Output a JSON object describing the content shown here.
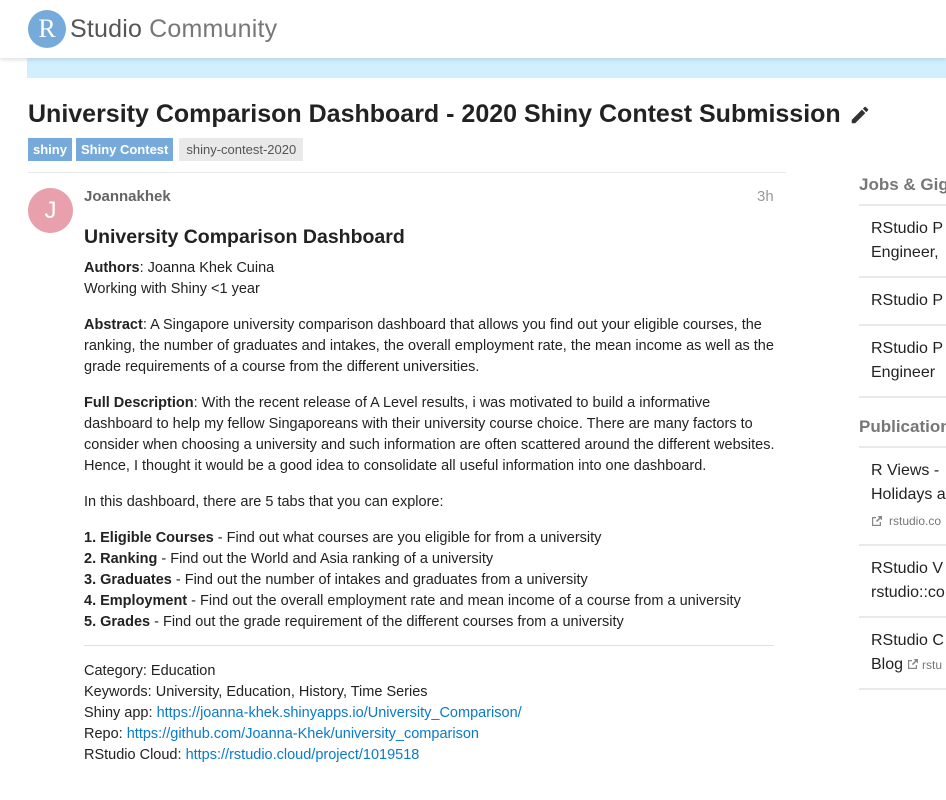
{
  "header": {
    "logo_letter": "R",
    "logo_studio": "Studio",
    "logo_community": "Community"
  },
  "topic": {
    "title": "University Comparison Dashboard - 2020 Shiny Contest Submission",
    "tags": [
      "shiny",
      "Shiny Contest",
      "shiny-contest-2020"
    ]
  },
  "post": {
    "avatar_letter": "J",
    "username": "Joannakhek",
    "time": "3h",
    "heading": "University Comparison Dashboard",
    "authors_label": "Authors",
    "authors_value": ": Joanna Khek Cuina",
    "experience": "Working with Shiny <1 year",
    "abstract_label": "Abstract",
    "abstract_text": ": A Singapore university comparison dashboard that allows you find out your eligible courses, the ranking, the number of graduates and intakes, the overall employment rate, the mean income as well as the grade requirements of a course from the different universities.",
    "full_desc_label": "Full Description",
    "full_desc_text": ": With the recent release of A Level results, i was motivated to build a informative dashboard to help my fellow Singaporeans with their university course choice. There are many factors to consider when choosing a university and such information are often scattered around the different websites. Hence, I thought it would be a good idea to consolidate all useful information into one dashboard.",
    "tabs_intro": "In this dashboard, there are 5 tabs that you can explore:",
    "tabs": [
      {
        "label": "1. Eligible Courses",
        "desc": " - Find out what courses are you eligible for from a university"
      },
      {
        "label": "2. Ranking",
        "desc": " - Find out the World and Asia ranking of a university"
      },
      {
        "label": "3. Graduates",
        "desc": " - Find out the number of intakes and graduates from a university"
      },
      {
        "label": "4. Employment",
        "desc": " - Find out the overall employment rate and mean income of a course from a university"
      },
      {
        "label": "5. Grades",
        "desc": " - Find out the grade requirement of the different courses from a university"
      }
    ],
    "meta": {
      "category": "Category: Education",
      "keywords": "Keywords: University, Education, History, Time Series",
      "shiny_label": "Shiny app: ",
      "shiny_url": "https://joanna-khek.shinyapps.io/University_Comparison/",
      "repo_label": "Repo: ",
      "repo_url": "https://github.com/Joanna-Khek/university_comparison",
      "cloud_label": "RStudio Cloud: ",
      "cloud_url": "https://rstudio.cloud/project/1019518"
    }
  },
  "sidebar": {
    "jobs_heading": "Jobs & Gigs",
    "jobs": [
      {
        "line1": "RStudio P",
        "line2": "Engineer,"
      },
      {
        "line1": "RStudio P",
        "line2": ""
      },
      {
        "line1": "RStudio P",
        "line2": "Engineer"
      }
    ],
    "pubs_heading": "Publications",
    "pubs": [
      {
        "line1": "R Views -",
        "line2": "Holidays a",
        "source": "rstudio.co"
      },
      {
        "line1": "RStudio V",
        "line2": "rstudio::co",
        "source": ""
      },
      {
        "line1": "RStudio C",
        "line2": "Blog",
        "source": "rstu"
      }
    ]
  }
}
